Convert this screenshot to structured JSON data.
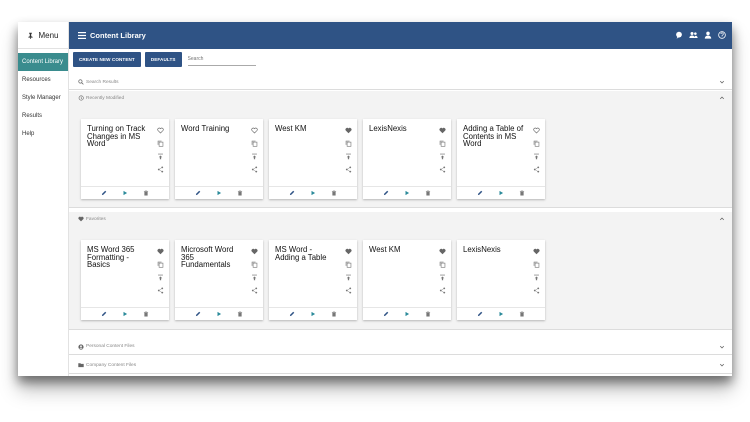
{
  "sidebar": {
    "menu_label": "Menu",
    "items": [
      {
        "label": "Content Library",
        "active": true
      },
      {
        "label": "Resources",
        "active": false
      },
      {
        "label": "Style Manager",
        "active": false
      },
      {
        "label": "Results",
        "active": false
      },
      {
        "label": "Help",
        "active": false
      }
    ]
  },
  "header": {
    "title": "Content Library",
    "icons": [
      "chat-icon",
      "group-icon",
      "user-icon",
      "help-icon"
    ]
  },
  "toolbar": {
    "create_label": "CREATE NEW CONTENT",
    "defaults_label": "DEFAULTS",
    "search_placeholder": "Search"
  },
  "sections": {
    "search_results": "Search Results",
    "recently_modified": "Recently Modified",
    "favorites": "Favorites",
    "personal": "Personal Content Files",
    "company": "Company Content Files"
  },
  "recent_cards": [
    {
      "title": "Turning on Track Changes in MS Word",
      "favorited": false
    },
    {
      "title": "Word Training",
      "favorited": false
    },
    {
      "title": "West KM",
      "favorited": true
    },
    {
      "title": "LexisNexis",
      "favorited": true
    },
    {
      "title": "Adding a Table of Contents in MS Word",
      "favorited": false
    }
  ],
  "favorite_cards": [
    {
      "title": "MS Word 365 Formatting - Basics",
      "favorited": true
    },
    {
      "title": "Microsoft Word 365 Fundamentals",
      "favorited": true
    },
    {
      "title": "MS Word - Adding a Table",
      "favorited": true
    },
    {
      "title": "West KM",
      "favorited": true
    },
    {
      "title": "LexisNexis",
      "favorited": true
    }
  ],
  "colors": {
    "header": "#2f5385",
    "sidebar_active": "#3a8c8e",
    "edit_icon": "#2f5385",
    "play_icon": "#2a8a9a",
    "icon_gray": "#777777"
  }
}
